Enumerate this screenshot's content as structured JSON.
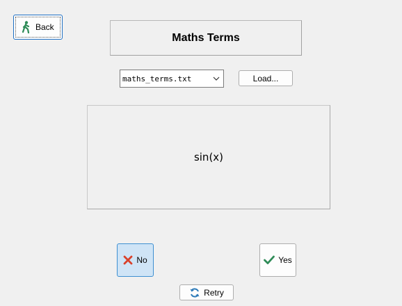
{
  "back": {
    "label": "Back",
    "icon": "walking-person-icon"
  },
  "title": "Maths Terms",
  "file_select": {
    "value": "maths_terms.txt",
    "icon": "chevron-down-icon"
  },
  "load": {
    "label": "Load..."
  },
  "term": "sin(x)",
  "answer": {
    "no_label": "No",
    "no_icon": "red-x-icon",
    "yes_label": "Yes",
    "yes_icon": "green-check-icon"
  },
  "retry": {
    "label": "Retry",
    "icon": "refresh-icon"
  },
  "colors": {
    "accent": "#3d8fd1",
    "no_bg": "#cfe4f6",
    "no_icon": "#d9412b",
    "yes_icon": "#2e8b57",
    "retry_icon": "#2c7ab8"
  }
}
